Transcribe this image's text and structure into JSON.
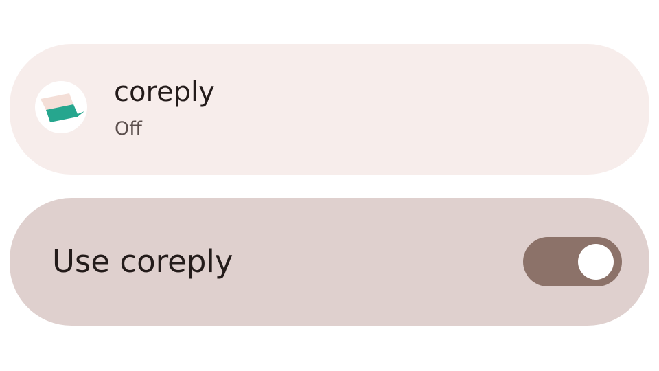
{
  "app_info": {
    "name": "coreply",
    "status": "Off",
    "icon": "coreply-app-icon"
  },
  "use_setting": {
    "label": "Use coreply",
    "enabled": true,
    "icon": "toggle-switch"
  },
  "colors": {
    "app_card_bg": "#f7edeb",
    "toggle_card_bg": "#dfd0ce",
    "switch_track": "#8c7269",
    "switch_thumb": "#ffffff",
    "icon_teal": "#26a68e",
    "icon_peach": "#f4dfd8"
  }
}
